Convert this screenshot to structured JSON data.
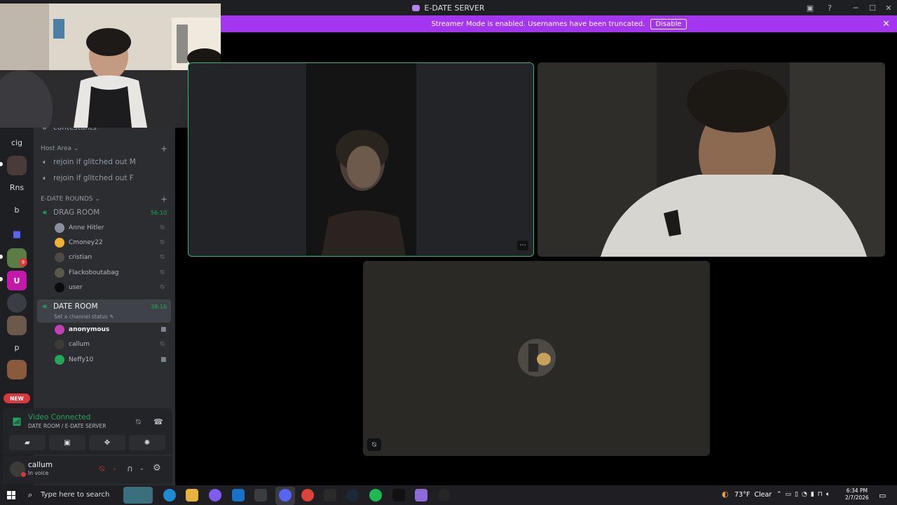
{
  "window": {
    "title": "E-DATE SERVER",
    "minimize": "─",
    "maximize": "☐",
    "close": "✕"
  },
  "banner": {
    "text": "Streamer Mode is enabled. Usernames have been truncated.",
    "button": "Disable",
    "close": "✕"
  },
  "rail": {
    "items": [
      "cig",
      "Rns",
      "b",
      "p"
    ],
    "new_badge": "NEW",
    "mention_count": "9"
  },
  "sidebar": {
    "partial_channel": "contestants",
    "host_area": {
      "label": "Host Area",
      "channels": [
        "rejoin if glitched out M",
        "rejoin if glitched out F"
      ]
    },
    "rounds": {
      "label": "E-DATE ROUNDS"
    },
    "drag_room": {
      "name": "DRAG ROOM",
      "timer": "56:10",
      "members": [
        "Anne Hitler",
        "Cmoney22",
        "cristian",
        "Flackoboutabag",
        "user"
      ]
    },
    "date_room": {
      "name": "DATE ROOM",
      "timer": "38:16",
      "status": "Set a channel status",
      "members": [
        "anonymous",
        "callum",
        "Neffy10"
      ]
    }
  },
  "voice": {
    "title": "Video Connected",
    "subtitle": "DATE ROOM / E-DATE SERVER"
  },
  "user": {
    "name": "callum",
    "status": "In voice"
  },
  "taskbar": {
    "search": "Type here to search",
    "temp": "73°F",
    "weather": "Clear",
    "time": "6:34 PM",
    "date": "2/7/2026"
  },
  "colors": {
    "accent": "#a536f0",
    "connected": "#23a55a",
    "speaking_border": "#3fb56e",
    "danger": "#da373c"
  }
}
